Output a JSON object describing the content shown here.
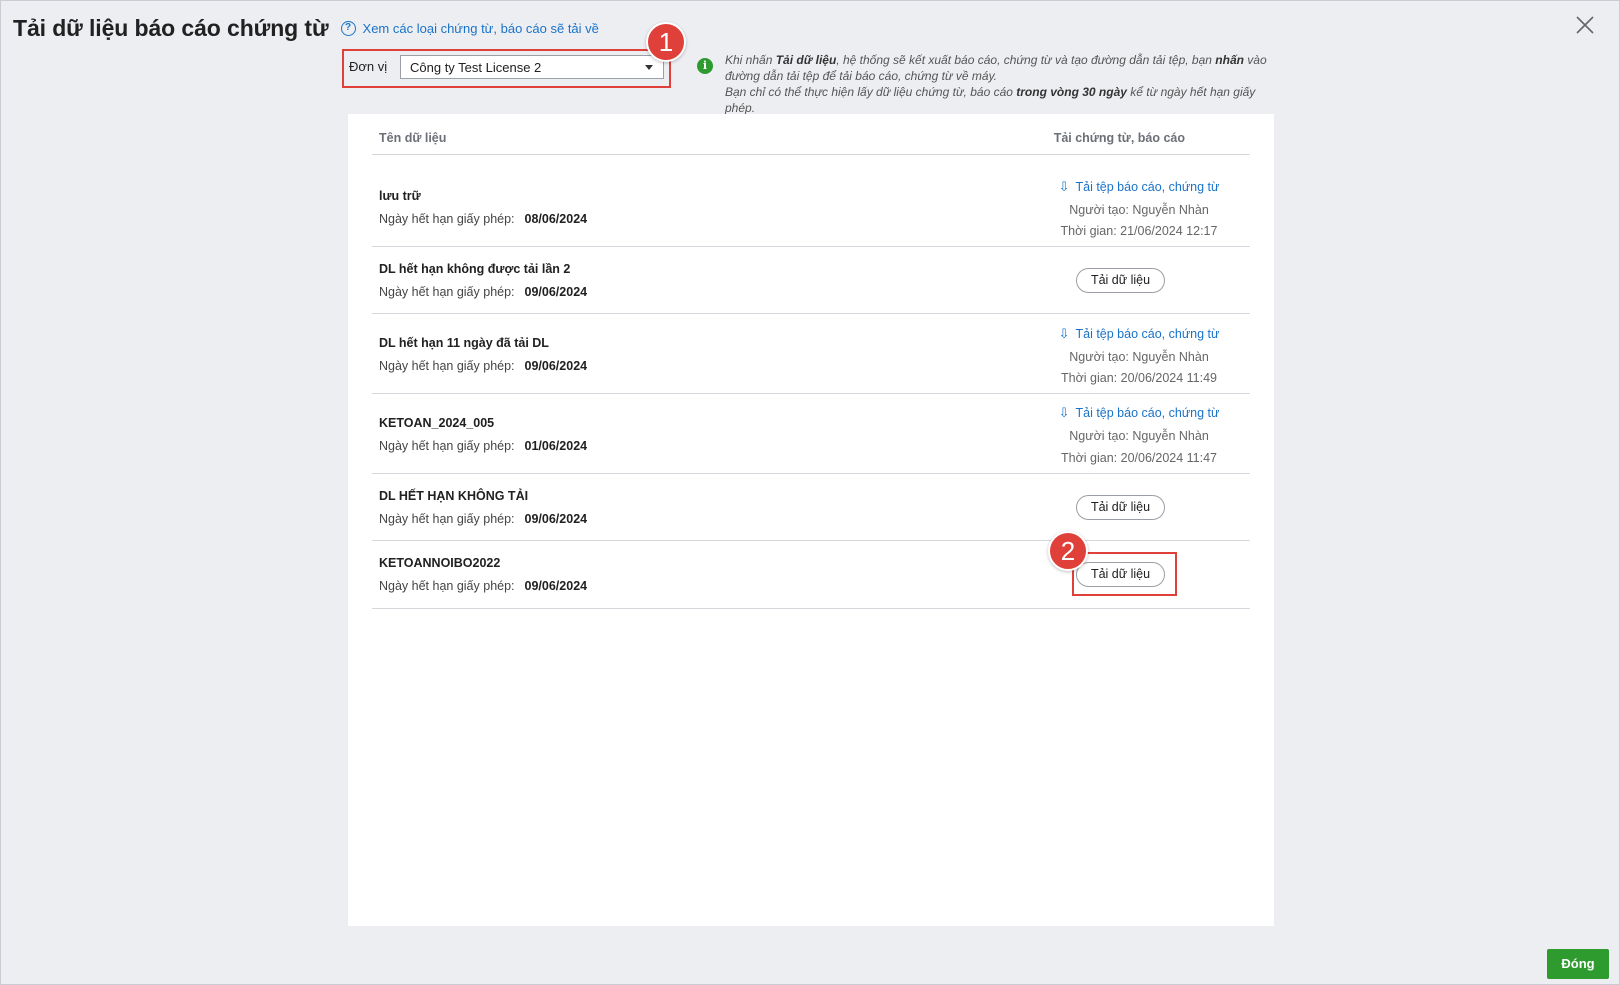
{
  "header": {
    "title": "Tải dữ liệu báo cáo chứng từ",
    "help_link": "Xem các loại chứng từ, báo cáo sẽ tải về"
  },
  "unit": {
    "label": "Đơn vị",
    "selected": "Công ty Test License 2"
  },
  "badges": {
    "one": "1",
    "two": "2"
  },
  "info": {
    "p1_a": "Khi nhấn ",
    "p1_b": "Tải dữ liệu",
    "p1_c": ", hệ thống sẽ kết xuất báo cáo, chứng từ và tạo đường dẫn tải tệp, bạn ",
    "p1_d": "nhấn",
    "p1_e": " vào đường dẫn tải tệp để tải báo cáo, chứng từ về máy.",
    "p2_a": "Bạn chỉ có thể thực hiện lấy dữ liệu chứng từ, báo cáo ",
    "p2_b": "trong vòng 30 ngày",
    "p2_c": " kể từ ngày hết hạn giấy phép."
  },
  "table": {
    "col_name": "Tên dữ liệu",
    "col_download": "Tải chứng từ, báo cáo",
    "expiry_label": "Ngày hết hạn giấy phép:",
    "link_label": "Tải tệp báo cáo, chứng từ",
    "button_label": "Tải dữ liệu",
    "rows": [
      {
        "name": "lưu trữ",
        "expiry": "08/06/2024",
        "creator": "Người tạo: Nguyễn Nhàn",
        "time": "Thời gian: 21/06/2024 12:17"
      },
      {
        "name": "DL hết hạn không được tải lần 2",
        "expiry": "09/06/2024"
      },
      {
        "name": "DL hết hạn 11 ngày đã tải DL",
        "expiry": "09/06/2024",
        "creator": "Người tạo: Nguyễn Nhàn",
        "time": "Thời gian: 20/06/2024 11:49"
      },
      {
        "name": "KETOAN_2024_005",
        "expiry": "01/06/2024",
        "creator": "Người tạo: Nguyễn Nhàn",
        "time": "Thời gian: 20/06/2024 11:47"
      },
      {
        "name": "DL HẾT HẠN KHÔNG TẢI",
        "expiry": "09/06/2024"
      },
      {
        "name": "KETOANNOIBO2022",
        "expiry": "09/06/2024"
      }
    ]
  },
  "footer": {
    "close_label": "Đóng"
  },
  "colors": {
    "accent_blue": "#1a73c8",
    "highlight_red": "#e0403a",
    "success_green": "#2e9b2e"
  }
}
